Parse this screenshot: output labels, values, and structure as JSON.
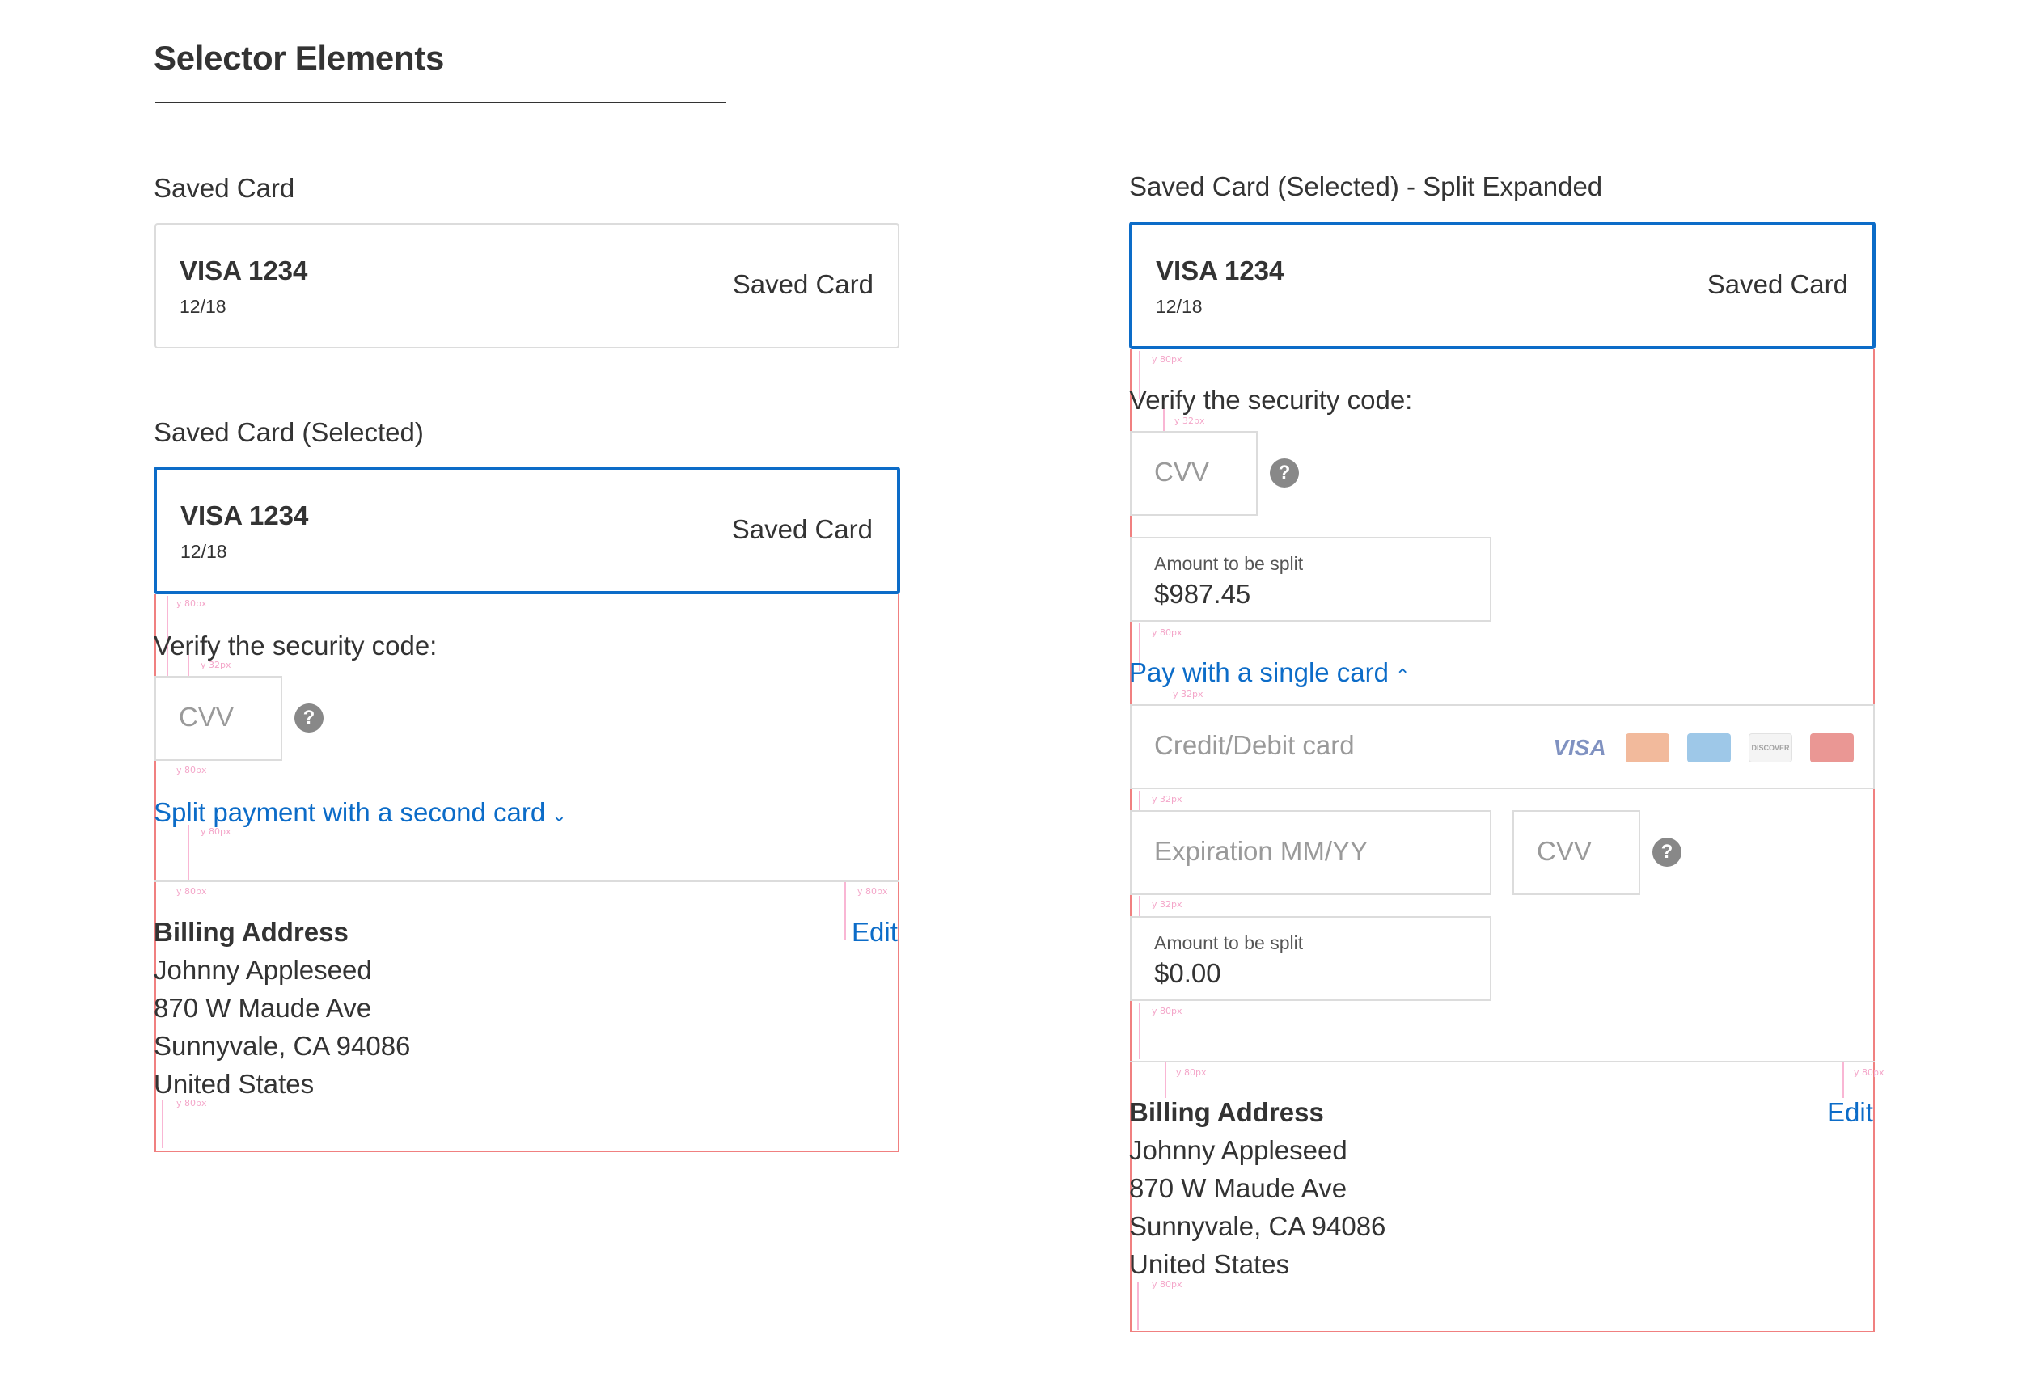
{
  "page": {
    "title": "Selector Elements"
  },
  "left": {
    "saved_card": {
      "section_label": "Saved Card",
      "brand": "VISA 1234",
      "expiry": "12/18",
      "type_label": "Saved Card"
    },
    "selected_card": {
      "section_label": "Saved Card (Selected)",
      "brand": "VISA 1234",
      "expiry": "12/18",
      "type_label": "Saved Card"
    },
    "verify_label": "Verify the security code:",
    "cvv_placeholder": "CVV",
    "split_link": "Split payment with a second card",
    "billing": {
      "heading": "Billing Address",
      "edit": "Edit",
      "name": "Johnny Appleseed",
      "street": "870 W Maude Ave",
      "city": "Sunnyvale, CA 94086",
      "country": "United States"
    }
  },
  "right": {
    "section_label": "Saved Card (Selected) - Split Expanded",
    "card": {
      "brand": "VISA 1234",
      "expiry": "12/18",
      "type_label": "Saved Card"
    },
    "verify_label": "Verify the security code:",
    "cvv_placeholder": "CVV",
    "split_amount_1": {
      "label": "Amount to be split",
      "value": "$987.45"
    },
    "single_card_link": "Pay with a single card",
    "credit_card_placeholder": "Credit/Debit card",
    "card_logos": [
      "VISA",
      "MasterCard",
      "AMEX",
      "DISCOVER",
      "UnionPay"
    ],
    "expiration_placeholder": "Expiration MM/YY",
    "cvv2_placeholder": "CVV",
    "split_amount_2": {
      "label": "Amount to be split",
      "value": "$0.00"
    },
    "billing": {
      "heading": "Billing Address",
      "edit": "Edit",
      "name": "Johnny Appleseed",
      "street": "870 W Maude Ave",
      "city": "Sunnyvale, CA 94086",
      "country": "United States"
    }
  },
  "spec_notes": {
    "a": "y 80px",
    "b": "y 32px"
  },
  "colors": {
    "accent": "#0c6cc8",
    "border": "#dcdcdc",
    "redline": "#f08080",
    "text": "#333333"
  },
  "icons": {
    "help": "question-circle-icon",
    "chevron_down": "chevron-down-icon",
    "chevron_up": "chevron-up-icon"
  }
}
